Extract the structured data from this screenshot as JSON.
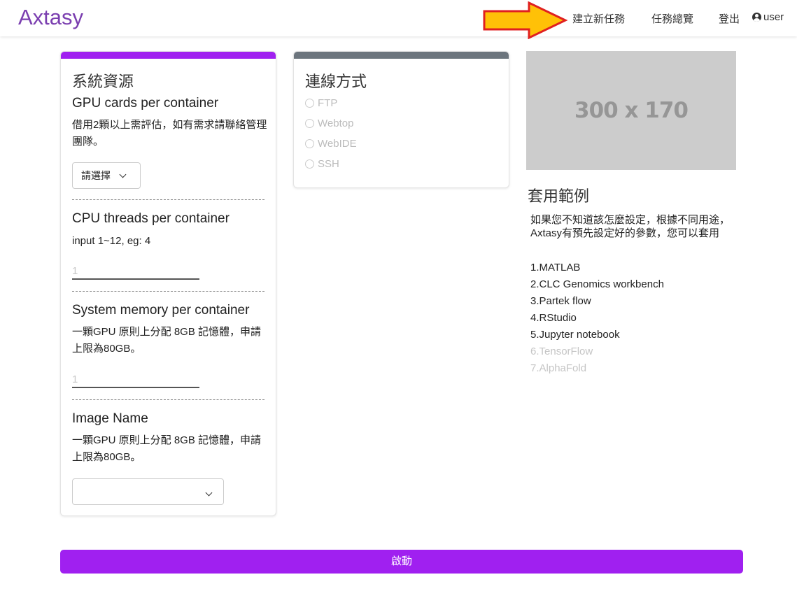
{
  "navbar": {
    "brand": "Axtasy",
    "links": {
      "create": "建立新任務",
      "overview": "任務總覽",
      "logout": "登出",
      "user": "user"
    },
    "annotation_arrow_color": "#ffc107"
  },
  "resources": {
    "title": "系統資源",
    "accent_color": "#a020f0",
    "gpu": {
      "title": "GPU cards per container",
      "desc": "借用2顆以上需評估，如有需求請聯絡管理團隊。",
      "select_label": "請選擇"
    },
    "cpu": {
      "title": "CPU threads per container",
      "desc": "input 1~12, eg: 4",
      "placeholder": "1"
    },
    "memory": {
      "title": "System memory per container",
      "desc": "一顆GPU 原則上分配 8GB 記憶體，申請上限為80GB。",
      "placeholder": "1"
    },
    "image": {
      "title": "Image Name",
      "desc": "一顆GPU 原則上分配 8GB 記憶體，申請上限為80GB。",
      "selected": ""
    }
  },
  "connection": {
    "title": "連線方式",
    "options": [
      "FTP",
      "Webtop",
      "WebIDE",
      "SSH"
    ]
  },
  "examples": {
    "image_text": "300 x 170",
    "title": "套用範例",
    "desc": "如果您不知道該怎麼設定，根據不同用途， Axtasy有預先設定好的參數，您可以套用",
    "items": [
      {
        "label": "1.MATLAB",
        "enabled": true
      },
      {
        "label": "2.CLC Genomics workbench",
        "enabled": true
      },
      {
        "label": "3.Partek flow",
        "enabled": true
      },
      {
        "label": "4.RStudio",
        "enabled": true
      },
      {
        "label": "5.Jupyter notebook",
        "enabled": true
      },
      {
        "label": "6.TensorFlow",
        "enabled": false
      },
      {
        "label": "7.AlphaFold",
        "enabled": false
      }
    ]
  },
  "start_button": "啟動"
}
